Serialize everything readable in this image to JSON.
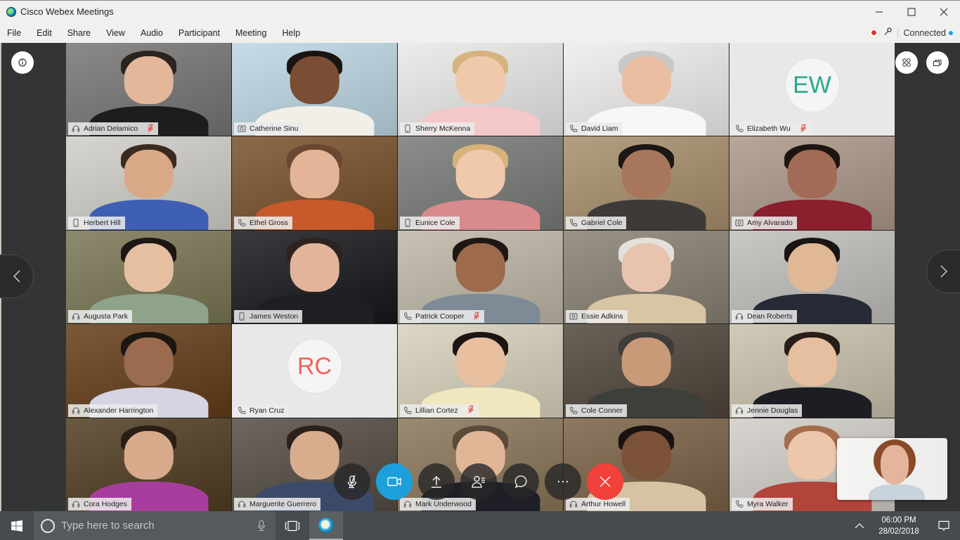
{
  "window": {
    "title": "Cisco Webex Meetings",
    "minimize_label": "Minimize",
    "maximize_label": "Maximize",
    "close_label": "Close"
  },
  "menu": {
    "items": [
      "File",
      "Edit",
      "Share",
      "View",
      "Audio",
      "Participant",
      "Meeting",
      "Help"
    ]
  },
  "status": {
    "recording_icon": "record-dot-icon",
    "lock_icon": "key-icon",
    "connection_label": "Connected",
    "connection_color": "#1ba0e1"
  },
  "stage": {
    "info_icon": "info-icon",
    "grid_view_icon": "grid-view-icon",
    "layout_icon": "stacked-windows-icon",
    "prev_page_icon": "chevron-left-icon",
    "next_page_icon": "chevron-right-icon",
    "active_speaker_color": "#1ba0e1"
  },
  "participants": [
    {
      "name": "Adrian Delamico",
      "device": "headset",
      "muted": true,
      "active": false
    },
    {
      "name": "Catherine Sinu",
      "device": "video",
      "muted": false,
      "active": true
    },
    {
      "name": "Sherry McKenna",
      "device": "mobile",
      "muted": false,
      "active": false
    },
    {
      "name": "David Liam",
      "device": "phone",
      "muted": false,
      "active": false
    },
    {
      "name": "Elizabeth Wu",
      "device": "phone",
      "muted": true,
      "active": false,
      "initials": "EW",
      "initials_color": "#2aa88e"
    },
    {
      "name": "Herbert Hill",
      "device": "mobile",
      "muted": false,
      "active": false
    },
    {
      "name": "Ethel Gross",
      "device": "phone",
      "muted": false,
      "active": false
    },
    {
      "name": "Eunice Cole",
      "device": "mobile",
      "muted": false,
      "active": false
    },
    {
      "name": "Gabriel Cole",
      "device": "phone",
      "muted": false,
      "active": false
    },
    {
      "name": "Amy Alvarado",
      "device": "video",
      "muted": false,
      "active": false
    },
    {
      "name": "Augusta Park",
      "device": "headset",
      "muted": false,
      "active": false
    },
    {
      "name": "James Weston",
      "device": "mobile",
      "muted": false,
      "active": false
    },
    {
      "name": "Patrick Cooper",
      "device": "phone",
      "muted": true,
      "active": false
    },
    {
      "name": "Essie Adkins",
      "device": "video",
      "muted": false,
      "active": false
    },
    {
      "name": "Dean Roberts",
      "device": "headset",
      "muted": false,
      "active": false
    },
    {
      "name": "Alexander Harrington",
      "device": "headset",
      "muted": false,
      "active": false
    },
    {
      "name": "Ryan Cruz",
      "device": "phone",
      "muted": false,
      "active": false,
      "initials": "RC",
      "initials_color": "#f0645a"
    },
    {
      "name": "Lillian Cortez",
      "device": "phone",
      "muted": true,
      "active": false
    },
    {
      "name": "Cole Conner",
      "device": "phone",
      "muted": false,
      "active": false
    },
    {
      "name": "Jennie Douglas",
      "device": "headset",
      "muted": false,
      "active": false
    },
    {
      "name": "Cora Hodges",
      "device": "headset",
      "muted": false,
      "active": false
    },
    {
      "name": "Marguerite Guerrero",
      "device": "headset",
      "muted": false,
      "active": false
    },
    {
      "name": "Mark Underwood",
      "device": "headset",
      "muted": false,
      "active": false
    },
    {
      "name": "Arthur Howell",
      "device": "headset",
      "muted": false,
      "active": false
    },
    {
      "name": "Myra Walker",
      "device": "phone",
      "muted": false,
      "active": false
    }
  ],
  "controls": {
    "mute": {
      "label": "Unmute",
      "icon": "microphone-muted-icon"
    },
    "video": {
      "label": "Stop video",
      "icon": "video-camera-icon",
      "color": "#1ba0dc"
    },
    "share": {
      "label": "Share content",
      "icon": "upload-share-icon"
    },
    "participants": {
      "label": "Participants",
      "icon": "participants-list-icon"
    },
    "chat": {
      "label": "Chat",
      "icon": "chat-bubble-icon"
    },
    "more": {
      "label": "More options",
      "icon": "ellipsis-icon"
    },
    "leave": {
      "label": "Leave meeting",
      "icon": "close-x-icon",
      "color": "#f2403a"
    }
  },
  "self_view": {
    "label": "Self view"
  },
  "taskbar": {
    "search_placeholder": "Type here to search",
    "time": "06:00 PM",
    "date": "28/02/2018"
  }
}
